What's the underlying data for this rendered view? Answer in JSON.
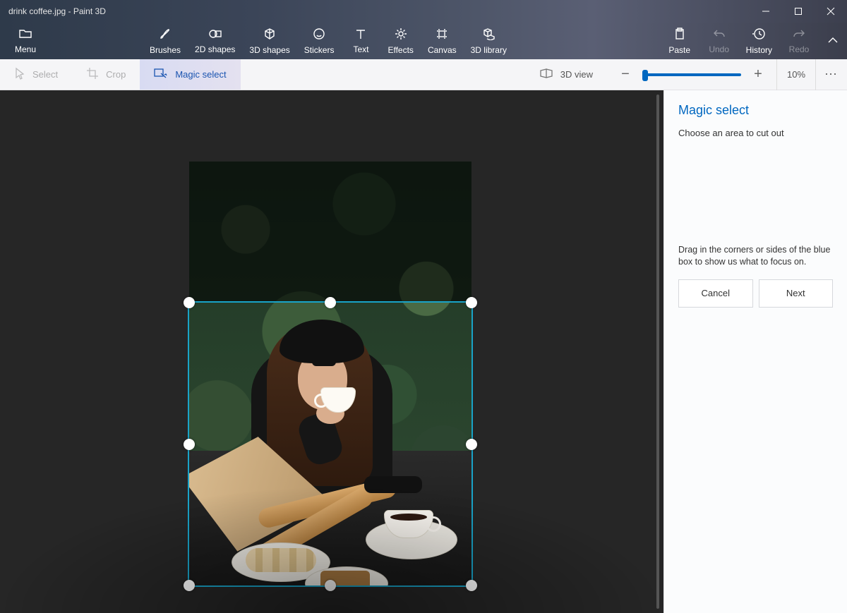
{
  "window": {
    "title": "drink coffee.jpg - Paint 3D"
  },
  "ribbon": {
    "menu": "Menu",
    "items": [
      {
        "id": "brushes",
        "label": "Brushes"
      },
      {
        "id": "shapes2d",
        "label": "2D shapes"
      },
      {
        "id": "shapes3d",
        "label": "3D shapes"
      },
      {
        "id": "stickers",
        "label": "Stickers"
      },
      {
        "id": "text",
        "label": "Text"
      },
      {
        "id": "effects",
        "label": "Effects"
      },
      {
        "id": "canvas",
        "label": "Canvas"
      },
      {
        "id": "library3d",
        "label": "3D library"
      }
    ],
    "right": [
      {
        "id": "paste",
        "label": "Paste",
        "disabled": false
      },
      {
        "id": "undo",
        "label": "Undo",
        "disabled": true
      },
      {
        "id": "history",
        "label": "History",
        "disabled": false
      },
      {
        "id": "redo",
        "label": "Redo",
        "disabled": true
      }
    ]
  },
  "secondary": {
    "select": "Select",
    "crop": "Crop",
    "magic_select": "Magic select",
    "view3d": "3D view",
    "zoom_percent": "10%"
  },
  "panel": {
    "title": "Magic select",
    "hint_top": "Choose an area to cut out",
    "hint_bottom": "Drag in the corners or sides of the blue box to show us what to focus on.",
    "cancel": "Cancel",
    "next": "Next"
  }
}
